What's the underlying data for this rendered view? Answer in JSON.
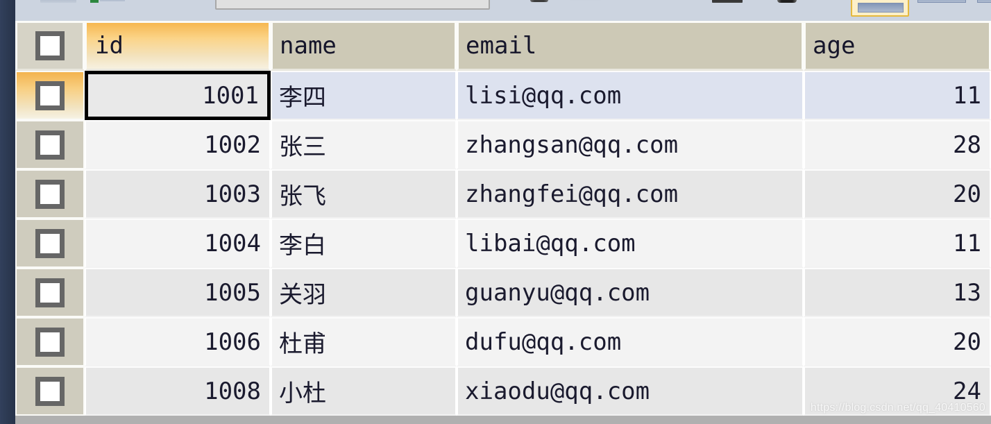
{
  "toolbar": {
    "combo_value": "",
    "combo_placeholder": "",
    "icons": [
      "grid-icon",
      "refresh-icon",
      "filter-icon",
      "sort-icon",
      "export-icon",
      "print-icon",
      "view-selected-icon",
      "view-icon",
      "panel-icon"
    ]
  },
  "grid": {
    "columns": [
      {
        "key": "check",
        "label": "",
        "align": "center",
        "selected": false
      },
      {
        "key": "id",
        "label": "id",
        "align": "right",
        "selected": true
      },
      {
        "key": "name",
        "label": "name",
        "align": "left",
        "selected": false
      },
      {
        "key": "email",
        "label": "email",
        "align": "left",
        "selected": false
      },
      {
        "key": "age",
        "label": "age",
        "align": "right",
        "selected": false
      }
    ],
    "rows": [
      {
        "id": "1001",
        "name": "李四",
        "email": "lisi@qq.com",
        "age": "11",
        "selected": true,
        "focused_cell": "id"
      },
      {
        "id": "1002",
        "name": "张三",
        "email": "zhangsan@qq.com",
        "age": "28",
        "selected": false,
        "focused_cell": ""
      },
      {
        "id": "1003",
        "name": "张飞",
        "email": "zhangfei@qq.com",
        "age": "20",
        "selected": false,
        "focused_cell": ""
      },
      {
        "id": "1004",
        "name": "李白",
        "email": "libai@qq.com",
        "age": "11",
        "selected": false,
        "focused_cell": ""
      },
      {
        "id": "1005",
        "name": "关羽",
        "email": "guanyu@qq.com",
        "age": "13",
        "selected": false,
        "focused_cell": ""
      },
      {
        "id": "1006",
        "name": "杜甫",
        "email": "dufu@qq.com",
        "age": "20",
        "selected": false,
        "focused_cell": ""
      },
      {
        "id": "1008",
        "name": "小杜",
        "email": "xiaodu@qq.com",
        "age": "24",
        "selected": false,
        "focused_cell": ""
      }
    ]
  },
  "watermark": {
    "text": "https://blog.csdn.net/qq_40410560"
  },
  "colors": {
    "rail": "#2d3a55",
    "chrome": "#ccd4e0",
    "header": "#cdc9b6",
    "header_selected_top": "#f6b750",
    "row_selected": "#dde2ef",
    "row_odd": "#f3f3f3",
    "row_even": "#e7e7e7",
    "focus_border": "#000000",
    "text": "#1a1a2e"
  }
}
